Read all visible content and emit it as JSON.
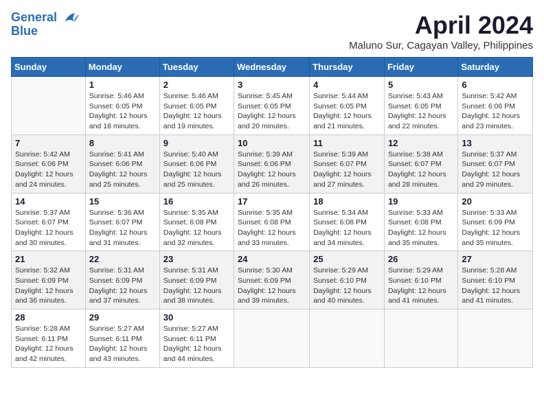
{
  "header": {
    "logo_line1": "General",
    "logo_line2": "Blue",
    "month_title": "April 2024",
    "subtitle": "Maluno Sur, Cagayan Valley, Philippines"
  },
  "calendar": {
    "weekdays": [
      "Sunday",
      "Monday",
      "Tuesday",
      "Wednesday",
      "Thursday",
      "Friday",
      "Saturday"
    ],
    "weeks": [
      [
        {
          "day": "",
          "info": ""
        },
        {
          "day": "1",
          "info": "Sunrise: 5:46 AM\nSunset: 6:05 PM\nDaylight: 12 hours\nand 18 minutes."
        },
        {
          "day": "2",
          "info": "Sunrise: 5:46 AM\nSunset: 6:05 PM\nDaylight: 12 hours\nand 19 minutes."
        },
        {
          "day": "3",
          "info": "Sunrise: 5:45 AM\nSunset: 6:05 PM\nDaylight: 12 hours\nand 20 minutes."
        },
        {
          "day": "4",
          "info": "Sunrise: 5:44 AM\nSunset: 6:05 PM\nDaylight: 12 hours\nand 21 minutes."
        },
        {
          "day": "5",
          "info": "Sunrise: 5:43 AM\nSunset: 6:05 PM\nDaylight: 12 hours\nand 22 minutes."
        },
        {
          "day": "6",
          "info": "Sunrise: 5:42 AM\nSunset: 6:06 PM\nDaylight: 12 hours\nand 23 minutes."
        }
      ],
      [
        {
          "day": "7",
          "info": "Sunrise: 5:42 AM\nSunset: 6:06 PM\nDaylight: 12 hours\nand 24 minutes."
        },
        {
          "day": "8",
          "info": "Sunrise: 5:41 AM\nSunset: 6:06 PM\nDaylight: 12 hours\nand 25 minutes."
        },
        {
          "day": "9",
          "info": "Sunrise: 5:40 AM\nSunset: 6:06 PM\nDaylight: 12 hours\nand 25 minutes."
        },
        {
          "day": "10",
          "info": "Sunrise: 5:39 AM\nSunset: 6:06 PM\nDaylight: 12 hours\nand 26 minutes."
        },
        {
          "day": "11",
          "info": "Sunrise: 5:39 AM\nSunset: 6:07 PM\nDaylight: 12 hours\nand 27 minutes."
        },
        {
          "day": "12",
          "info": "Sunrise: 5:38 AM\nSunset: 6:07 PM\nDaylight: 12 hours\nand 28 minutes."
        },
        {
          "day": "13",
          "info": "Sunrise: 5:37 AM\nSunset: 6:07 PM\nDaylight: 12 hours\nand 29 minutes."
        }
      ],
      [
        {
          "day": "14",
          "info": "Sunrise: 5:37 AM\nSunset: 6:07 PM\nDaylight: 12 hours\nand 30 minutes."
        },
        {
          "day": "15",
          "info": "Sunrise: 5:36 AM\nSunset: 6:07 PM\nDaylight: 12 hours\nand 31 minutes."
        },
        {
          "day": "16",
          "info": "Sunrise: 5:35 AM\nSunset: 6:08 PM\nDaylight: 12 hours\nand 32 minutes."
        },
        {
          "day": "17",
          "info": "Sunrise: 5:35 AM\nSunset: 6:08 PM\nDaylight: 12 hours\nand 33 minutes."
        },
        {
          "day": "18",
          "info": "Sunrise: 5:34 AM\nSunset: 6:08 PM\nDaylight: 12 hours\nand 34 minutes."
        },
        {
          "day": "19",
          "info": "Sunrise: 5:33 AM\nSunset: 6:08 PM\nDaylight: 12 hours\nand 35 minutes."
        },
        {
          "day": "20",
          "info": "Sunrise: 5:33 AM\nSunset: 6:09 PM\nDaylight: 12 hours\nand 35 minutes."
        }
      ],
      [
        {
          "day": "21",
          "info": "Sunrise: 5:32 AM\nSunset: 6:09 PM\nDaylight: 12 hours\nand 36 minutes."
        },
        {
          "day": "22",
          "info": "Sunrise: 5:31 AM\nSunset: 6:09 PM\nDaylight: 12 hours\nand 37 minutes."
        },
        {
          "day": "23",
          "info": "Sunrise: 5:31 AM\nSunset: 6:09 PM\nDaylight: 12 hours\nand 38 minutes."
        },
        {
          "day": "24",
          "info": "Sunrise: 5:30 AM\nSunset: 6:09 PM\nDaylight: 12 hours\nand 39 minutes."
        },
        {
          "day": "25",
          "info": "Sunrise: 5:29 AM\nSunset: 6:10 PM\nDaylight: 12 hours\nand 40 minutes."
        },
        {
          "day": "26",
          "info": "Sunrise: 5:29 AM\nSunset: 6:10 PM\nDaylight: 12 hours\nand 41 minutes."
        },
        {
          "day": "27",
          "info": "Sunrise: 5:28 AM\nSunset: 6:10 PM\nDaylight: 12 hours\nand 41 minutes."
        }
      ],
      [
        {
          "day": "28",
          "info": "Sunrise: 5:28 AM\nSunset: 6:11 PM\nDaylight: 12 hours\nand 42 minutes."
        },
        {
          "day": "29",
          "info": "Sunrise: 5:27 AM\nSunset: 6:11 PM\nDaylight: 12 hours\nand 43 minutes."
        },
        {
          "day": "30",
          "info": "Sunrise: 5:27 AM\nSunset: 6:11 PM\nDaylight: 12 hours\nand 44 minutes."
        },
        {
          "day": "",
          "info": ""
        },
        {
          "day": "",
          "info": ""
        },
        {
          "day": "",
          "info": ""
        },
        {
          "day": "",
          "info": ""
        }
      ]
    ]
  }
}
